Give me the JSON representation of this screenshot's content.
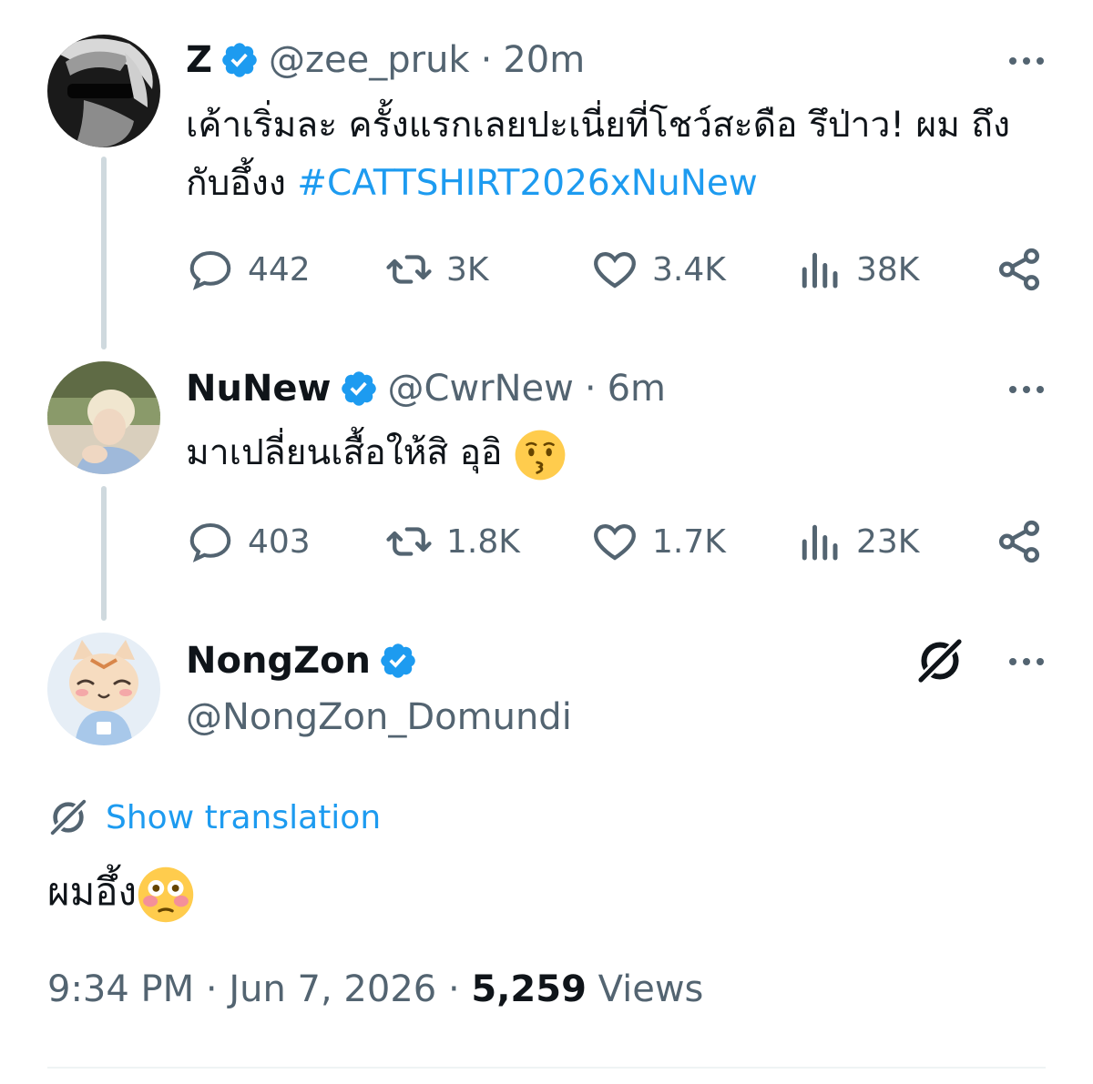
{
  "tweets": [
    {
      "display_name": "Z",
      "handle": "@zee_pruk",
      "time": "20m",
      "text": "เค้าเริ่มละ ครั้งแรกเลยปะเนี่ยที่โชว์สะดือ รึป่าว! ผม ถึงกับอึ้งง ",
      "hashtag": "#CATTSHIRT2026xNuNew",
      "replies": "442",
      "reposts": "3K",
      "likes": "3.4K",
      "views": "38K"
    },
    {
      "display_name": "NuNew",
      "handle": "@CwrNew",
      "time": "6m",
      "text": "มาเปลี่ยนเสื้อให้สิ อุอิ ",
      "replies": "403",
      "reposts": "1.8K",
      "likes": "1.7K",
      "views": "23K"
    }
  ],
  "main_tweet": {
    "display_name": "NongZon",
    "handle": "@NongZon_Domundi",
    "show_translation": "Show translation",
    "text": "ผมอึ้ง",
    "time": "9:34 PM",
    "date": "Jun 7, 2026",
    "view_count": "5,259",
    "views_label": "Views",
    "separator": "·"
  },
  "icons": {
    "verified": "verified-badge-icon",
    "reply": "reply-icon",
    "repost": "repost-icon",
    "like": "heart-icon",
    "views": "analytics-icon",
    "share": "share-icon",
    "more": "more-icon",
    "grok": "grok-icon"
  },
  "colors": {
    "accent": "#1d9bf0",
    "text": "#0f1419",
    "muted": "#536471",
    "thread_line": "#cfd9de"
  }
}
